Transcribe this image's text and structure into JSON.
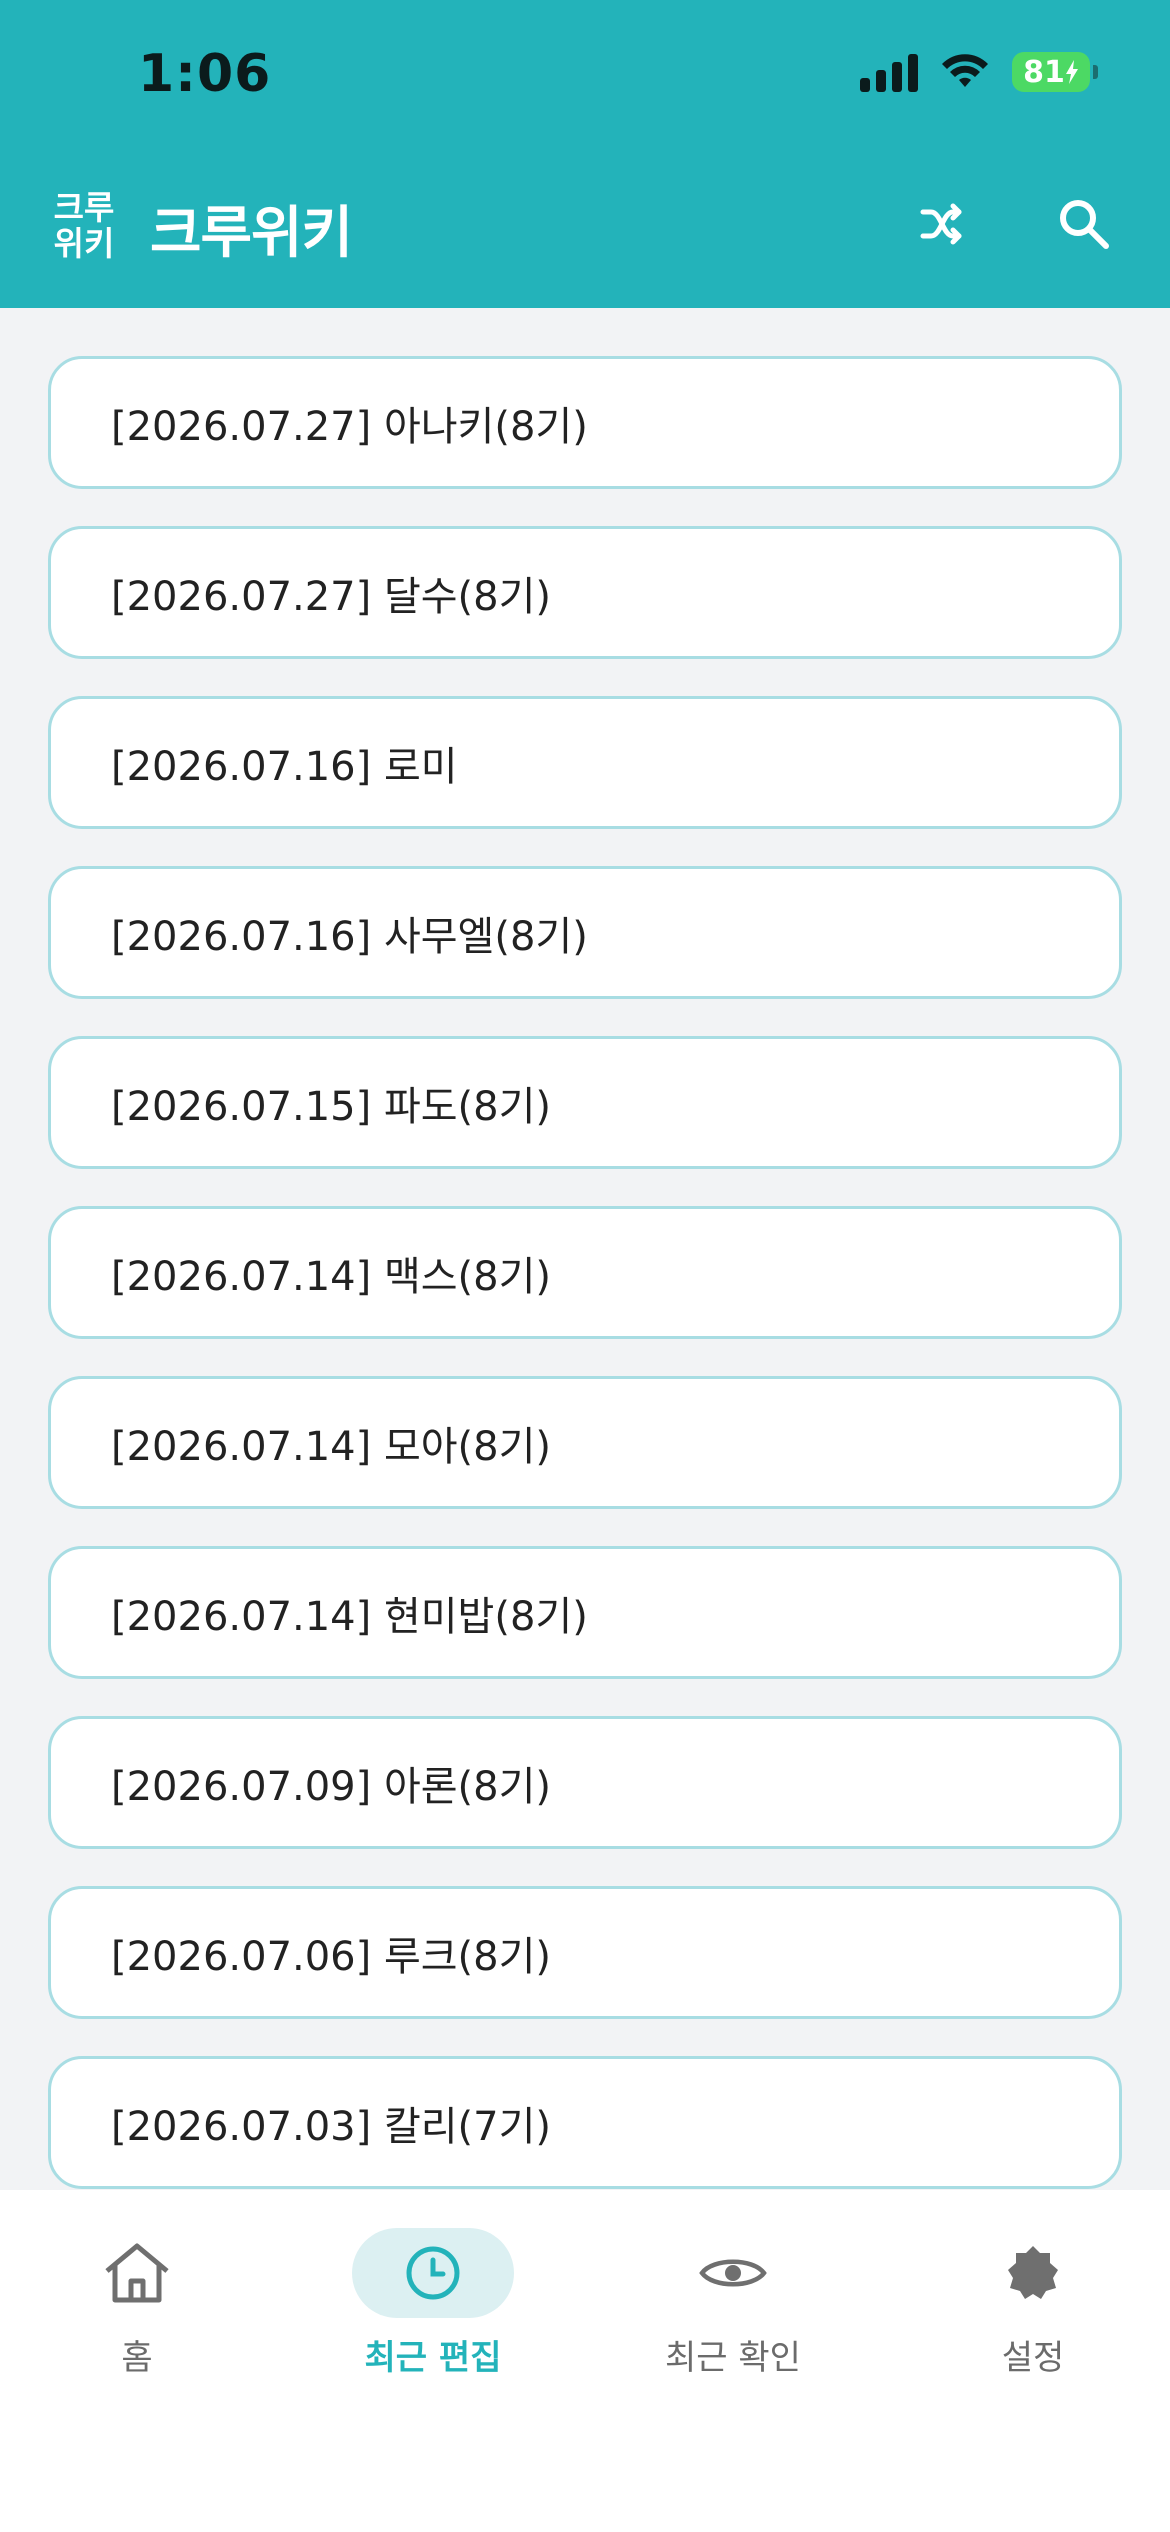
{
  "status_bar": {
    "time": "1:06",
    "battery": "81"
  },
  "app_bar": {
    "logo_line1": "크루",
    "logo_line2": "위키",
    "title": "크루위키",
    "shuffle_icon": "shuffle-icon",
    "search_icon": "search-icon"
  },
  "recent_edits": [
    "[2026.07.27] 아나키(8기)",
    "[2026.07.27] 달수(8기)",
    "[2026.07.16] 로미",
    "[2026.07.16] 사무엘(8기)",
    "[2026.07.15] 파도(8기)",
    "[2026.07.14] 맥스(8기)",
    "[2026.07.14] 모아(8기)",
    "[2026.07.14] 현미밥(8기)",
    "[2026.07.09] 아론(8기)",
    "[2026.07.06] 루크(8기)",
    "[2026.07.03] 칼리(7기)"
  ],
  "bottom_nav": {
    "items": [
      {
        "label": "홈",
        "icon": "home-icon"
      },
      {
        "label": "최근 편집",
        "icon": "clock-icon"
      },
      {
        "label": "최근 확인",
        "icon": "eye-icon"
      },
      {
        "label": "설정",
        "icon": "gear-icon"
      }
    ],
    "active_index": 1
  },
  "colors": {
    "brand": "#23b3ba",
    "item_border": "#a8dde3",
    "background": "#f2f3f5",
    "nav_active_bg": "#dcf0f2"
  }
}
